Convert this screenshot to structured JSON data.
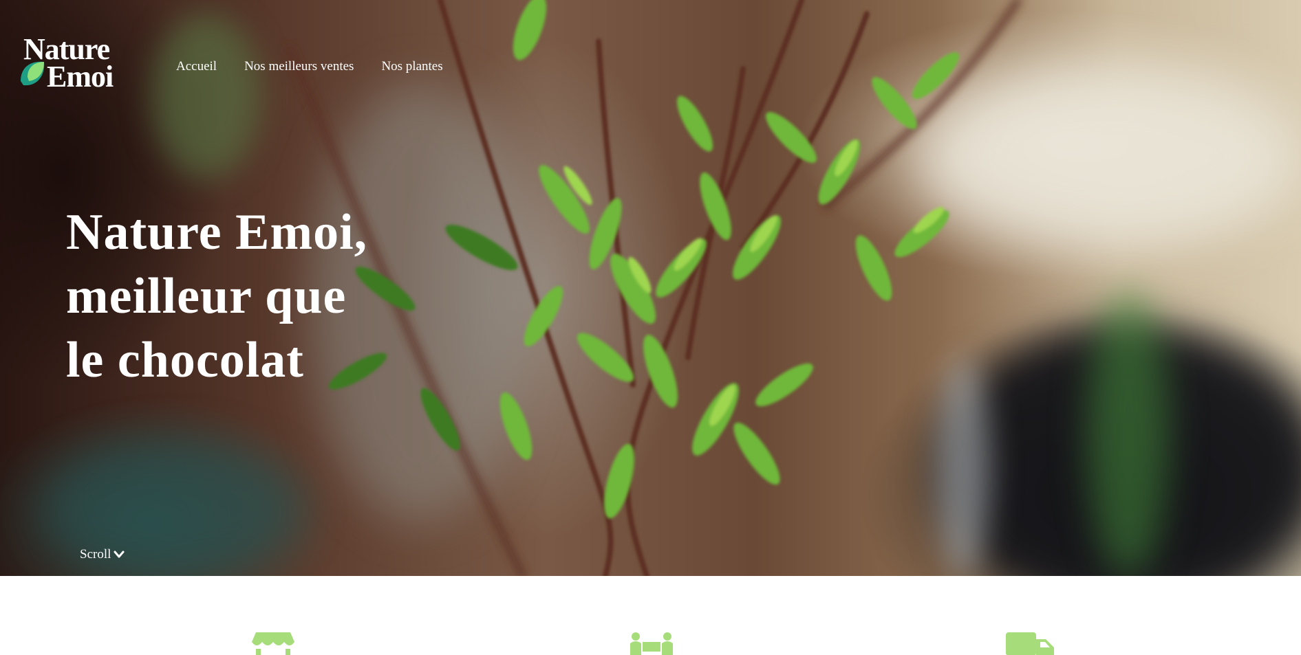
{
  "brand": {
    "logo_line1": "Nature",
    "logo_line2": "Emoi",
    "colors": {
      "white": "#ffffff",
      "accent_green": "#a6dd7a",
      "leaf_light": "#8fe07a",
      "leaf_teal": "#1f9e86"
    }
  },
  "nav": {
    "items": [
      {
        "label": "Accueil"
      },
      {
        "label": "Nos meilleurs ventes"
      },
      {
        "label": "Nos plantes"
      }
    ]
  },
  "hero": {
    "headline_lines": [
      "Nature Emoi,",
      "meilleur que",
      "le chocolat"
    ],
    "scroll_label": "Scroll",
    "scroll_icon": "chevron-down-icon",
    "background": "blurred green plant branches photo"
  },
  "features": {
    "icons": [
      {
        "icon": "store-icon"
      },
      {
        "icon": "handshake-icon"
      },
      {
        "icon": "truck-icon"
      }
    ]
  }
}
